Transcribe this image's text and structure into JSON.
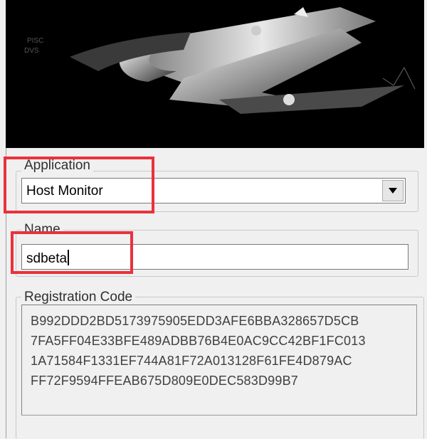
{
  "application_group": {
    "label": "Application",
    "selected": "Host Monitor"
  },
  "name_group": {
    "label": "Name",
    "value": "sdbeta"
  },
  "registration_group": {
    "label": "Registration Code",
    "lines": [
      "B992DDD2BD5173975905EDD3AFE6BBA328657D5CB",
      "7FA5FF04E33BFE489ADBB76B4E0AC9CC42BF1FC013",
      "1A71584F1331EF744A81F72A013128F61FE4D879AC",
      "FF72F9594FFEAB675D809E0DEC583D99B7"
    ]
  },
  "colors": {
    "highlight": "#e8323c"
  }
}
